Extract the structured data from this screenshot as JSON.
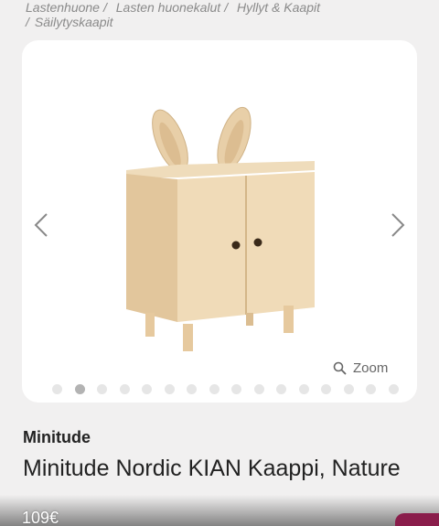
{
  "breadcrumb": {
    "items": [
      "Lastenhuone",
      "Lasten huonekalut",
      "Hyllyt & Kaapit",
      "Säilytyskaapit"
    ],
    "separator": "/"
  },
  "gallery": {
    "image_icon": "bunny-cabinet-image",
    "prev_icon": "chevron-left-icon",
    "next_icon": "chevron-right-icon",
    "zoom_label": "Zoom",
    "dot_count": 16,
    "active_index": 1
  },
  "product": {
    "brand": "Minitude",
    "title": "Minitude Nordic KIAN Kaappi, Nature",
    "price": "109€"
  },
  "colors": {
    "background": "#f1f0f0",
    "card": "#ffffff",
    "accent": "#8a1d4b"
  }
}
